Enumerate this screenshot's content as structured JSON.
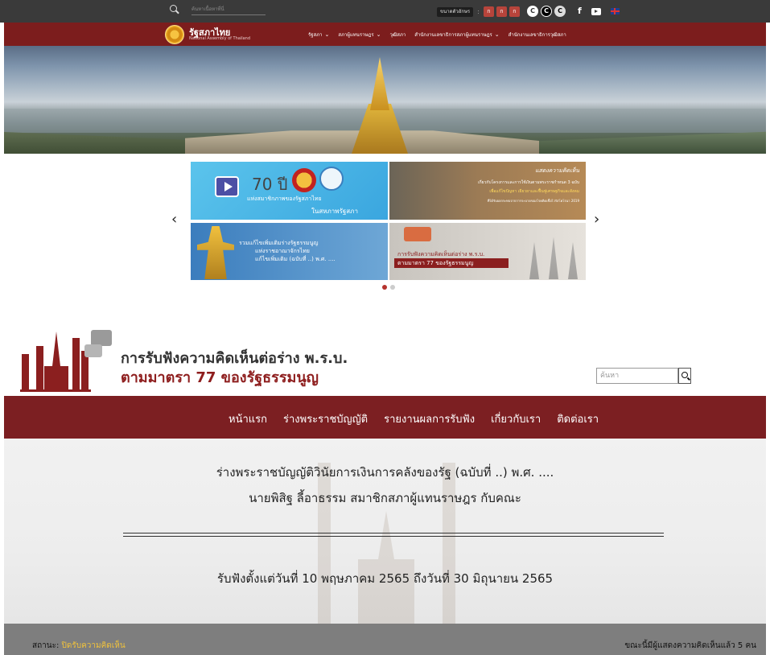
{
  "topbar": {
    "search_placeholder": "ค้นหาเนื้อหาที่นี่",
    "font_size_label": "ขนาดตัวอักษร",
    "font_buttons": [
      "ก",
      "ก",
      "ก"
    ],
    "contrast_buttons": [
      "C",
      "C",
      "C"
    ],
    "icons": [
      "search-icon",
      "facebook-icon",
      "youtube-icon",
      "uk-flag-icon"
    ]
  },
  "mainnav": {
    "brand_title": "รัฐสภาไทย",
    "brand_subtitle": "National Assembly of Thailand",
    "items": [
      {
        "label": "รัฐสภา"
      },
      {
        "label": "สภาผู้แทนราษฎร"
      },
      {
        "label": "วุฒิสภา"
      },
      {
        "label": "สำนักงานเลขาธิการสภาผู้แทนราษฎร"
      },
      {
        "label": "สำนักงานเลขาธิการวุฒิสภา"
      }
    ]
  },
  "carousel": {
    "prev": "‹",
    "next": "›",
    "card1": {
      "number": "70 ปี",
      "line1": "แห่งสมาชิกภาพของรัฐสภาไทย",
      "line2": "ในสหภาพรัฐสภา"
    },
    "card2": {
      "heading": "แสดงความคิดเห็น",
      "line1": "เกี่ยวกับโครงการและการใช้เงินตามพระราชกำหนด 3 ฉบับ",
      "line2": "เพื่อแก้ไขปัญหา เยียวยาและฟื้นฟูเศรษฐกิจและสังคม",
      "line3": "ที่ได้รับผลกระทบจากการระบาดของโรคติดเชื้อไวรัสโคโรนา 2019"
    },
    "card3": {
      "line1": "รวมแก้ไขเพิ่มเติมร่างรัฐธรรมนูญ",
      "line2": "แห่งราชอาณาจักรไทย",
      "line3": "แก้ไขเพิ่มเติม (ฉบับที่ ..) พ.ศ. ...."
    },
    "card4": {
      "line1": "การรับฟังความคิดเห็นต่อร่าง พ.ร.บ.",
      "line2": "ตามมาตรา 77 ของรัฐธรรมนูญ"
    },
    "slides": 2,
    "active_slide": 1
  },
  "site": {
    "title_line1": "การรับฟังความคิดเห็นต่อร่าง พ.ร.บ.",
    "title_line2": "ตามมาตรา 77 ของรัฐธรรมนูญ",
    "search_placeholder": "ค้นหา",
    "nav": [
      {
        "label": "หน้าแรก"
      },
      {
        "label": "ร่างพระราชบัญญัติ"
      },
      {
        "label": "รายงานผลการรับฟัง"
      },
      {
        "label": "เกี่ยวกับเรา"
      },
      {
        "label": "ติดต่อเรา"
      }
    ]
  },
  "bill": {
    "title": "ร่างพระราชบัญญัติวินัยการเงินการคลังของรัฐ (ฉบับที่ ..) พ.ศ. ....",
    "proposer": "นายพิสิฐ ลี้อาธรรม สมาชิกสภาผู้แทนราษฎร กับคณะ",
    "period": "รับฟังตั้งแต่วันที่ 10 พฤษภาคม 2565 ถึงวันที่ 30 มิถุนายน 2565"
  },
  "status": {
    "label": "สถานะ:",
    "value": "ปิดรับความคิดเห็น",
    "count_text": "ขณะนี้มีผู้แสดงความคิดเห็นแล้ว 5 คน"
  },
  "colors": {
    "topbar": "#3a3a3a",
    "parliament_red": "#7c1d1d",
    "site_red": "#7c1f22",
    "status_highlight": "#f0c23c"
  }
}
